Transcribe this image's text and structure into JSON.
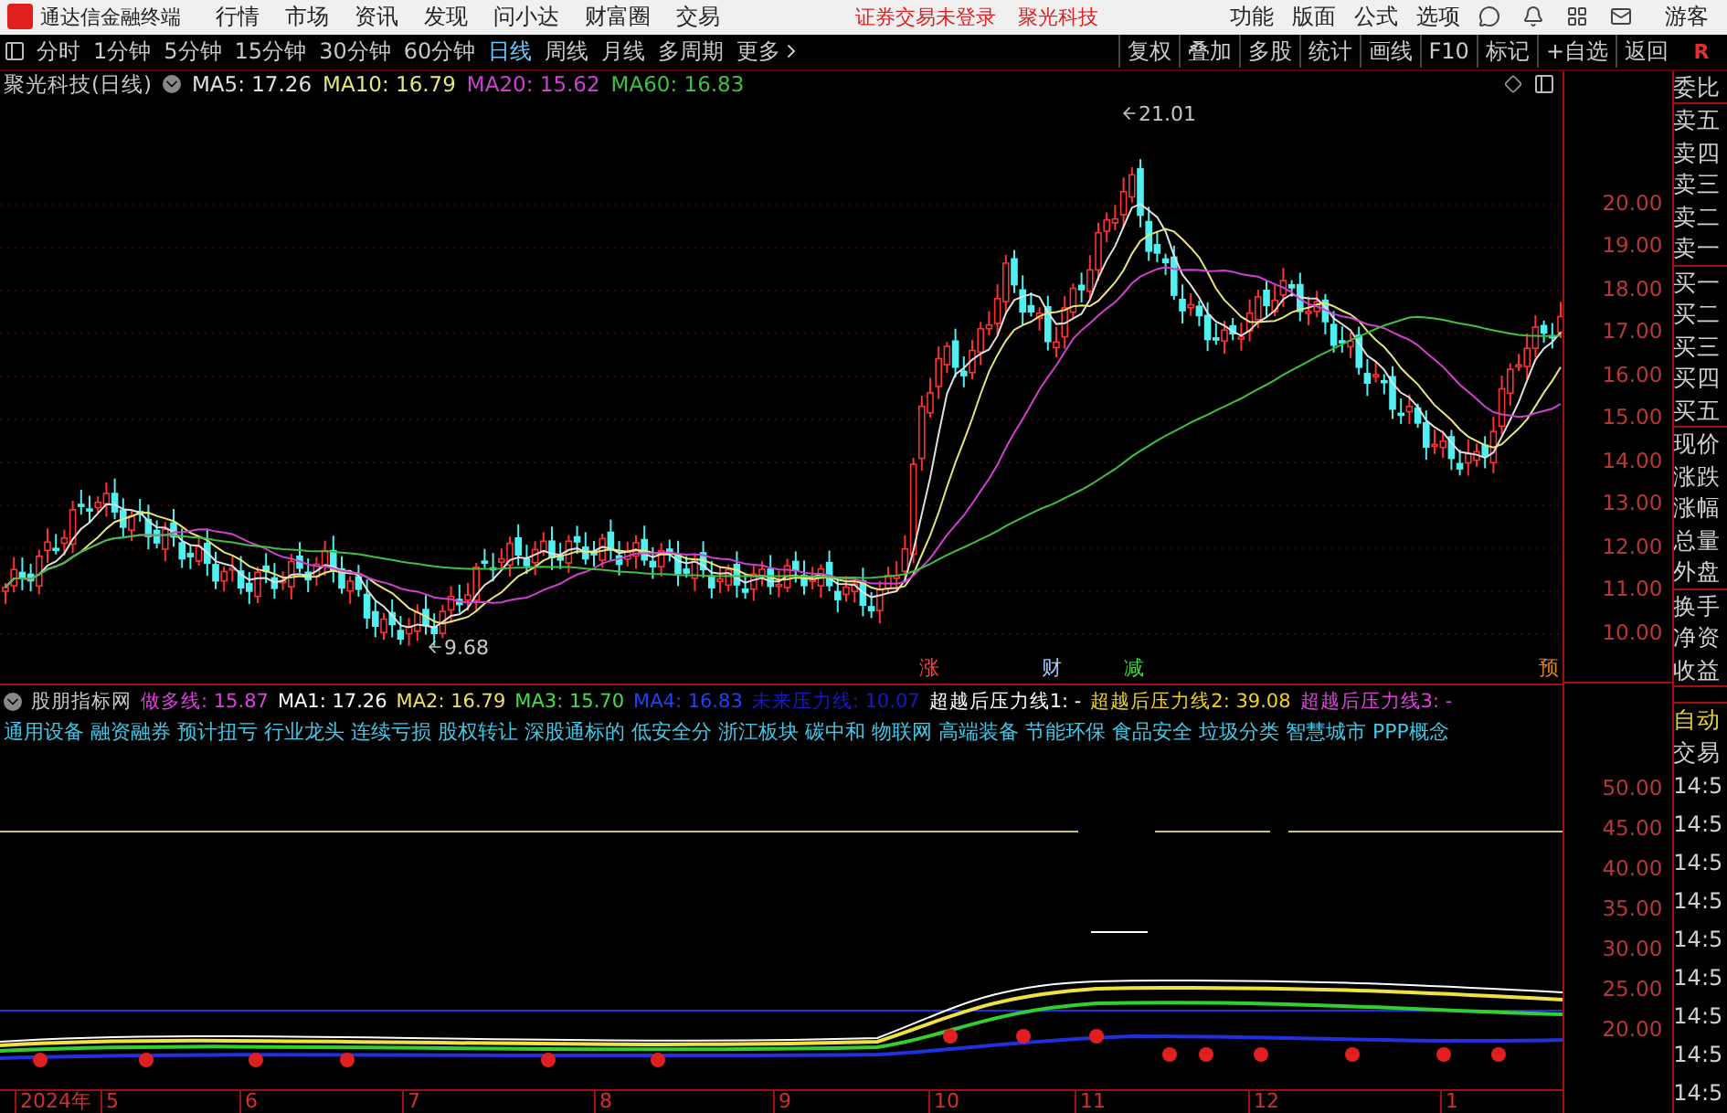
{
  "app_bar": {
    "title": "通达信金融终端",
    "menu": [
      "行情",
      "市场",
      "资讯",
      "发现",
      "问小达",
      "财富圈",
      "交易"
    ],
    "notice": "证券交易未登录",
    "stock": "聚光科技",
    "right_menu": [
      "功能",
      "版面",
      "公式",
      "选项"
    ],
    "user": "游客"
  },
  "period_bar": {
    "periods": [
      {
        "label": "分时",
        "selected": false
      },
      {
        "label": "1分钟",
        "selected": false
      },
      {
        "label": "5分钟",
        "selected": false
      },
      {
        "label": "15分钟",
        "selected": false
      },
      {
        "label": "30分钟",
        "selected": false
      },
      {
        "label": "60分钟",
        "selected": false
      },
      {
        "label": "日线",
        "selected": true
      },
      {
        "label": "周线",
        "selected": false
      },
      {
        "label": "月线",
        "selected": false
      },
      {
        "label": "多周期",
        "selected": false
      }
    ],
    "more": "更多",
    "tools": [
      "复权",
      "叠加",
      "多股",
      "统计",
      "画线",
      "F10",
      "标记",
      "+自选",
      "返回"
    ],
    "corner": "R"
  },
  "price_chart": {
    "title": "聚光科技(日线)",
    "ma": [
      {
        "label": "MA5: 17.26",
        "color": "#e0e0e0"
      },
      {
        "label": "MA10: 16.79",
        "color": "#e6e67a"
      },
      {
        "label": "MA20: 15.62",
        "color": "#d040d0"
      },
      {
        "label": "MA60: 16.83",
        "color": "#40c040"
      }
    ],
    "high_label": "21.01",
    "low_label": "9.68",
    "axis": [
      "20.00",
      "19.00",
      "18.00",
      "17.00",
      "16.00",
      "15.00",
      "14.00",
      "13.00",
      "12.00",
      "11.00",
      "10.00"
    ],
    "markers": [
      {
        "text": "涨",
        "color": "#ff4040"
      },
      {
        "text": "财",
        "color": "#a0c8ff"
      },
      {
        "text": "减",
        "color": "#40d040"
      },
      {
        "text": "预",
        "color": "#e08020"
      }
    ]
  },
  "indicator": {
    "title": "股朋指标网",
    "legend": [
      {
        "text": "做多线: 15.87",
        "color": "#e040e0"
      },
      {
        "text": "MA1: 17.26",
        "color": "#ffffff"
      },
      {
        "text": "MA2: 16.79",
        "color": "#f0e060"
      },
      {
        "text": "MA3: 15.70",
        "color": "#40e040"
      },
      {
        "text": "MA4: 16.83",
        "color": "#2040ff"
      },
      {
        "text": "未来压力线: 10.07",
        "color": "#1818c8"
      },
      {
        "text": "超越后压力线1: -",
        "color": "#ffffff"
      },
      {
        "text": "超越后压力线2: 39.08",
        "color": "#f0d020"
      },
      {
        "text": "超越后压力线3: -",
        "color": "#e040e0"
      }
    ],
    "concepts": "通用设备 融资融券 预计扭亏 行业龙头 连续亏损 股权转让 深股通标的 低安全分 浙江板块 碳中和 物联网 高端装备 节能环保 食品安全 垃圾分类 智慧城市 PPP概念",
    "axis": [
      "50.00",
      "45.00",
      "40.00",
      "35.00",
      "30.00",
      "25.00",
      "20.00"
    ]
  },
  "date_axis": [
    "2024年",
    "5",
    "6",
    "7",
    "8",
    "9",
    "10",
    "11",
    "12",
    "1"
  ],
  "quote_panel": {
    "groups": [
      [
        "委比"
      ],
      [
        "卖五",
        "卖四",
        "卖三",
        "卖二",
        "卖一"
      ],
      [
        "买一",
        "买二",
        "买三",
        "买四",
        "买五"
      ],
      [
        "现价",
        "涨跌",
        "涨幅",
        "总量",
        "外盘"
      ],
      [
        "换手",
        "净资",
        "收益"
      ]
    ],
    "auto": "自动",
    "trade": "交易",
    "times": [
      "14:5",
      "14:5",
      "14:5",
      "14:5",
      "14:5",
      "14:5",
      "14:5",
      "14:5",
      "14:5"
    ]
  }
}
